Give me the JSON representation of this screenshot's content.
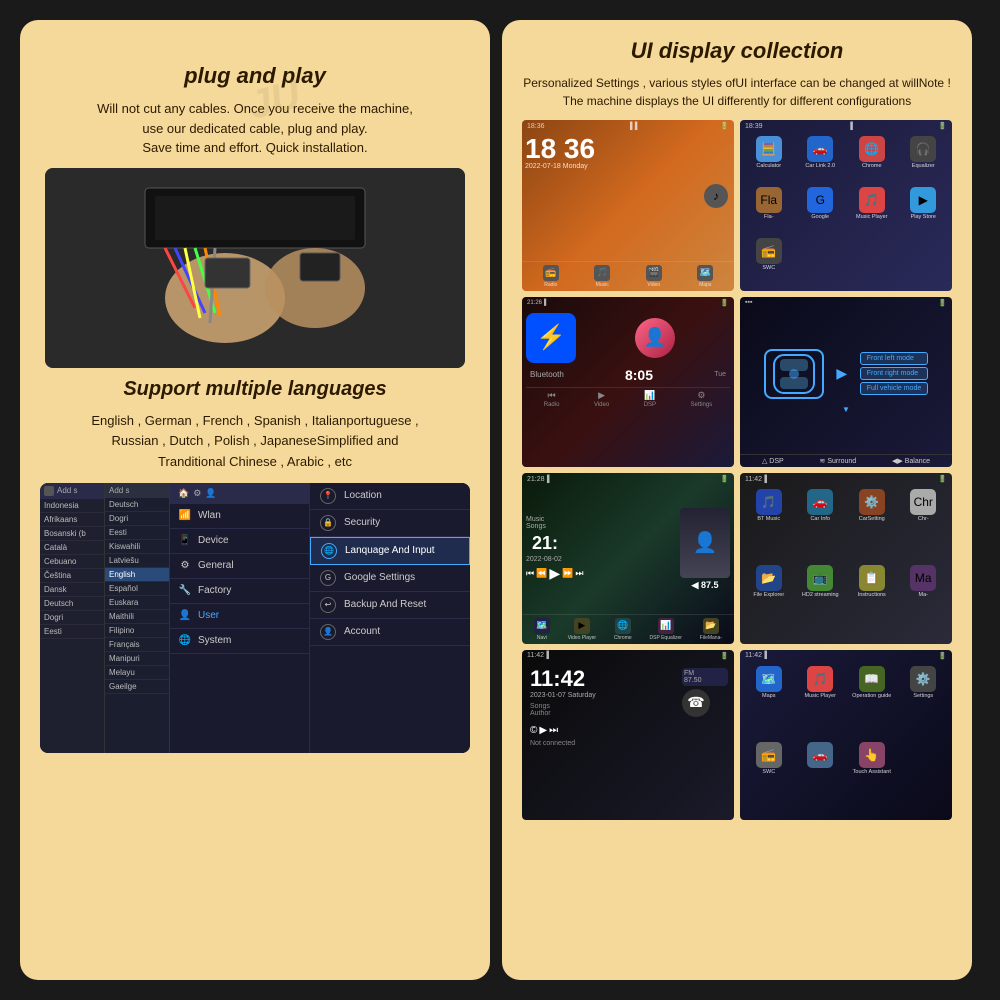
{
  "left_panel": {
    "plug_title": "plug and play",
    "plug_desc": "Will not cut any cables. Once you receive the machine,\nuse our dedicated cable, plug and play.\nSave time and effort. Quick installation.",
    "lang_title": "Support multiple languages",
    "lang_desc": "English , German , French , Spanish , Italianportuguese ,\nRussian , Dutch , Polish , JapaneseSimplified and\nTranditional Chinese , Arabic , etc",
    "settings_ui": {
      "lang_list1": [
        "Indonesia",
        "Afrikaans",
        "Bosanski (b",
        "Català",
        "Cebuano",
        "Čeština",
        "Dansk",
        "Deutsch",
        "Dogri",
        "Eesti"
      ],
      "lang_list2": [
        "Deutsch",
        "Dogri",
        "Eesti",
        "Kiswahili",
        "Latviešu",
        "English",
        "Español",
        "Euskara",
        "Maithili",
        "Filipino",
        "Français",
        "Manipuri",
        "Melayu",
        "Gaeilge"
      ],
      "header_label": "Add s",
      "settings_items": [
        {
          "label": "Wlan",
          "icon": "wifi"
        },
        {
          "label": "Device",
          "icon": "device"
        },
        {
          "label": "General",
          "icon": "gear"
        },
        {
          "label": "Factory",
          "icon": "wrench"
        },
        {
          "label": "User",
          "icon": "user",
          "active": true
        },
        {
          "label": "System",
          "icon": "system"
        }
      ],
      "detail_items": [
        {
          "label": "Location",
          "icon": "location"
        },
        {
          "label": "Security",
          "icon": "security"
        },
        {
          "label": "Lanquage And Input",
          "icon": "language",
          "active": true
        },
        {
          "label": "Google Settings",
          "icon": "google"
        },
        {
          "label": "Backup And Reset",
          "icon": "backup"
        },
        {
          "label": "Account",
          "icon": "account"
        }
      ]
    }
  },
  "right_panel": {
    "ui_title": "UI display collection",
    "ui_desc": "Personalized Settings , various styles ofUI interface can be changed at willNote !\nThe machine displays the UI differently for different configurations",
    "screens": [
      {
        "id": "screen1",
        "time": "18 36",
        "date": "2022-07-18  Monday",
        "apps": [
          "📻",
          "🎵",
          "🎬",
          "🗺️"
        ],
        "app_labels": [
          "Radio",
          "Music",
          "Video",
          "Maps"
        ]
      },
      {
        "id": "screen2",
        "apps": [
          "🧮",
          "🚗",
          "🌐",
          "🎧",
          "🔍",
          "🎵",
          "🛒",
          "📻"
        ],
        "app_labels": [
          "Calculator",
          "Car Link 2.0",
          "Chrome",
          "Equalizer",
          "Fla-",
          "Google",
          "Music Player",
          "Play Store",
          "SWC"
        ]
      },
      {
        "id": "screen3",
        "bluetooth": true,
        "time": "8:05"
      },
      {
        "id": "screen4",
        "car_view": true,
        "options": [
          "Front left mode",
          "Front right mode",
          "Full vehicle mode"
        ]
      },
      {
        "id": "screen5",
        "music": true,
        "time": "21:",
        "tempo": "87.5"
      },
      {
        "id": "screen6",
        "apps": [
          "🎵",
          "🚗",
          "⚙️",
          "📁",
          "📺",
          "📱",
          "📂",
          "🎬"
        ],
        "app_labels": [
          "BT Music",
          "Car Info",
          "CarSetting",
          "Chr-",
          "Navi",
          "Video Player",
          "Chrome",
          "DSP Equalizer",
          "FileMana-",
          "File Explorer",
          "HD2 streaming",
          "Instructions",
          "Ma-"
        ]
      },
      {
        "id": "screen7",
        "time": "11:42",
        "date": "2023-01-07  Saturday",
        "music": true
      },
      {
        "id": "screen8",
        "apps": [
          "🗺️",
          "🎵",
          "📖",
          "⚙️",
          "📻",
          "🚗",
          "👆"
        ],
        "app_labels": [
          "Maps",
          "Music Player",
          "Operation guide",
          "Settings",
          "SWC",
          "Touch Assistant"
        ]
      }
    ]
  }
}
